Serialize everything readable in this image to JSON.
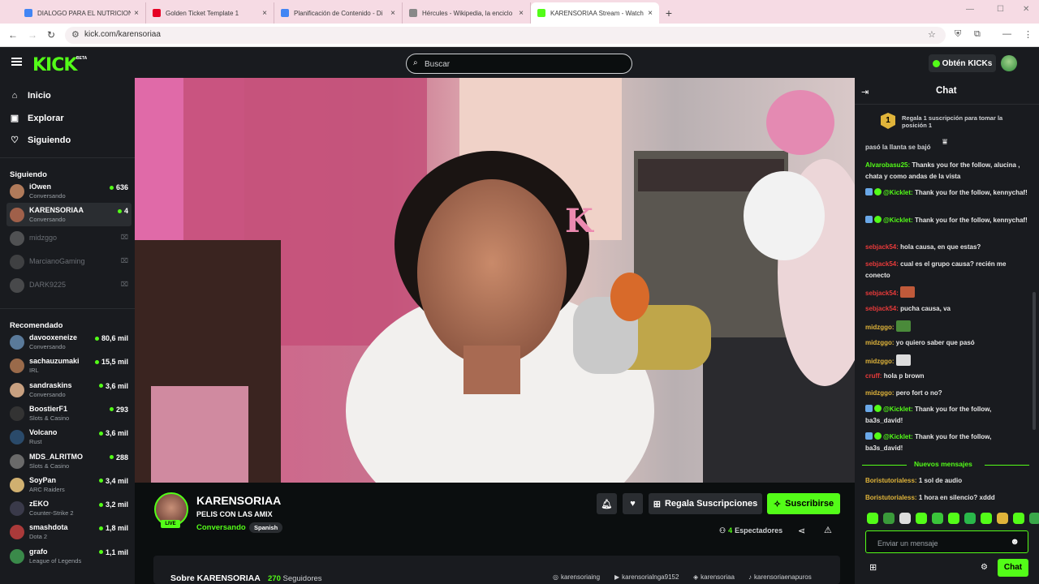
{
  "browser": {
    "tabs": [
      {
        "title": "DIALOGO PARA EL NUTRICIONI",
        "color": "#4285f4"
      },
      {
        "title": "Golden Ticket Template 1",
        "color": "#e60023"
      },
      {
        "title": "Planificación de Contenido - Di",
        "color": "#4285f4"
      },
      {
        "title": "Hércules - Wikipedia, la enciclo",
        "color": "#888888"
      },
      {
        "title": "KARENSORIAA Stream - Watch",
        "color": "#53fc18"
      }
    ],
    "url": "kick.com/karensoriaa"
  },
  "topbar": {
    "logo": "KICK",
    "beta": "BETA",
    "search_placeholder": "Buscar",
    "kicks_label": "Obtén KICKs"
  },
  "sidebar": {
    "nav": [
      {
        "label": "Inicio",
        "icon": "home-icon"
      },
      {
        "label": "Explorar",
        "icon": "compass-icon"
      },
      {
        "label": "Siguiendo",
        "icon": "heart-icon"
      }
    ],
    "following_header": "Siguiendo",
    "following": [
      {
        "name": "iOwen",
        "category": "Conversando",
        "viewers": "636",
        "live": true,
        "avatar": "#b07a5a"
      },
      {
        "name": "KARENSORIAA",
        "category": "Conversando",
        "viewers": "4",
        "live": true,
        "avatar": "#a0604a"
      },
      {
        "name": "midzggo",
        "category": "",
        "viewers": "",
        "live": false,
        "avatar": "#888888"
      },
      {
        "name": "MarcianoGaming",
        "category": "",
        "viewers": "",
        "live": false,
        "avatar": "#666666"
      },
      {
        "name": "DARK9225",
        "category": "",
        "viewers": "",
        "live": false,
        "avatar": "#777777"
      }
    ],
    "recommended_header": "Recomendado",
    "recommended": [
      {
        "name": "davooxeneize",
        "category": "Conversando",
        "viewers": "80,6 mil",
        "avatar": "#5a7a9a"
      },
      {
        "name": "sachauzumaki",
        "category": "IRL",
        "viewers": "15,5 mil",
        "avatar": "#9a6a4a"
      },
      {
        "name": "sandraskins",
        "category": "Conversando",
        "viewers": "3,6 mil",
        "avatar": "#c8a080"
      },
      {
        "name": "BoostierF1",
        "category": "Slots & Casino",
        "viewers": "293",
        "avatar": "#333333"
      },
      {
        "name": "Volcano",
        "category": "Rust",
        "viewers": "3,6 mil",
        "avatar": "#2a4a6a"
      },
      {
        "name": "MDS_ALRITMO",
        "category": "Slots & Casino",
        "viewers": "288",
        "avatar": "#6a6a6a"
      },
      {
        "name": "SoyPan",
        "category": "ARC Raiders",
        "viewers": "3,4 mil",
        "avatar": "#d0b070"
      },
      {
        "name": "zEKO",
        "category": "Counter-Strike 2",
        "viewers": "3,2 mil",
        "avatar": "#3a3a4a"
      },
      {
        "name": "smashdota",
        "category": "Dota 2",
        "viewers": "1,8 mil",
        "avatar": "#aa3a3a"
      },
      {
        "name": "grafo",
        "category": "League of Legends",
        "viewers": "1,1 mil",
        "avatar": "#3a8a4a"
      }
    ]
  },
  "stream": {
    "channel": "KARENSORIAA",
    "title": "PELIS CON LAS AMIX",
    "category": "Conversando",
    "language": "Spanish",
    "live_badge": "LIVE",
    "gift_label": "Regala Suscripciones",
    "subscribe_label": "Suscribirse",
    "viewers_count": "4",
    "viewers_label": "Espectadores",
    "about_title": "Sobre KARENSORIAA",
    "followers_count": "270",
    "followers_label": "Seguidores",
    "socials": [
      {
        "label": "karensoriaing",
        "icon": "instagram-icon"
      },
      {
        "label": "karensorialnga9152",
        "icon": "youtube-icon"
      },
      {
        "label": "karensoriaa",
        "icon": "discord-icon"
      },
      {
        "label": "karensoriaenapuros",
        "icon": "tiktok-icon"
      }
    ]
  },
  "chat": {
    "title": "Chat",
    "pinned_rank": "1",
    "pinned_text": "Regala 1 suscripción para tomar la posición 1",
    "partial_top": "pasó la llanta se bajó",
    "messages": [
      {
        "user": "Alvarobasu25:",
        "color": "#53fc18",
        "text": "Thanks you for the follow, alucina , chata y como andas de la vista",
        "bot": false
      },
      {
        "user": "@Kicklet:",
        "color": "#53fc18",
        "text": "Thank you for the follow, kennychaf!",
        "bot": true
      },
      {
        "user": "@Kicklet:",
        "color": "#53fc18",
        "text": "Thank you for the follow, kennychaf!",
        "bot": true
      },
      {
        "user": "sebjack54:",
        "color": "#e83a3a",
        "text": "hola causa, en que estas?",
        "bot": false
      },
      {
        "user": "sebjack54:",
        "color": "#e83a3a",
        "text": "cual es el grupo causa? recién me conecto",
        "bot": false
      },
      {
        "user": "sebjack54:",
        "color": "#e83a3a",
        "text": "",
        "bot": false,
        "emote": "#c05a3a"
      },
      {
        "user": "sebjack54:",
        "color": "#e83a3a",
        "text": "pucha causa, va",
        "bot": false
      },
      {
        "user": "midzggo:",
        "color": "#e0b43a",
        "text": "",
        "bot": false,
        "emote": "#4a8a3a"
      },
      {
        "user": "midzggo:",
        "color": "#e0b43a",
        "text": "yo quiero saber que pasó",
        "bot": false
      },
      {
        "user": "midzggo:",
        "color": "#e0b43a",
        "text": "",
        "bot": false,
        "emote": "#dddddd"
      },
      {
        "user": "cruff:",
        "color": "#e83a3a",
        "text": "hola p brown",
        "bot": false
      },
      {
        "user": "midzggo:",
        "color": "#e0b43a",
        "text": "pero fort o no?",
        "bot": false
      },
      {
        "user": "@Kicklet:",
        "color": "#53fc18",
        "text": "Thank you for the follow, ba3s_david!",
        "bot": true
      },
      {
        "user": "@Kicklet:",
        "color": "#53fc18",
        "text": "Thank you for the follow, ba3s_david!",
        "bot": true
      }
    ],
    "new_messages_label": "Nuevos mensajes",
    "new_messages": [
      {
        "user": "Boristutorialess:",
        "color": "#e0b43a",
        "text": "1 sol de audio"
      },
      {
        "user": "Boristutorialess:",
        "color": "#e0b43a",
        "text": "1 hora en silencio? xddd"
      }
    ],
    "input_placeholder": "Enviar un mensaje",
    "send_label": "Chat"
  }
}
